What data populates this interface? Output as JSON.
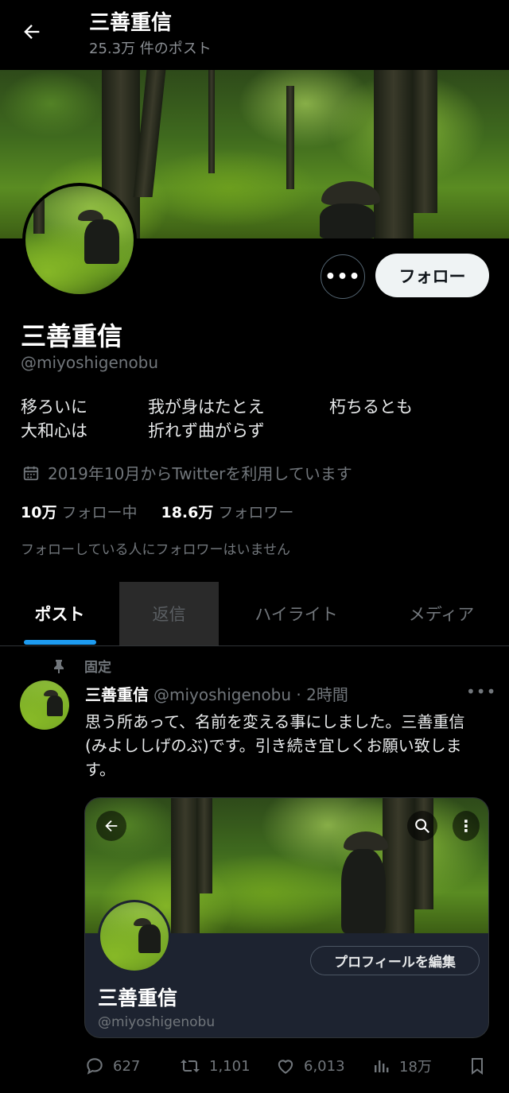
{
  "header": {
    "title": "三善重信",
    "subtitle": "25.3万 件のポスト"
  },
  "profile": {
    "name": "三善重信",
    "handle": "@miyoshigenobu",
    "follow_label": "フォロー",
    "more_label": "•••",
    "bio": {
      "col1": "移ろいに\n大和心は",
      "col2": "我が身はたとえ\n折れず曲がらず",
      "col3": "朽ちるとも"
    },
    "joined": "2019年10月からTwitterを利用しています",
    "following_count": "10万",
    "following_label": "フォロー中",
    "followers_count": "18.6万",
    "followers_label": "フォロワー",
    "mutual_note": "フォローしている人にフォロワーはいません"
  },
  "tabs": [
    {
      "label": "ポスト",
      "active": true
    },
    {
      "label": "返信",
      "active": false
    },
    {
      "label": "ハイライト",
      "active": false
    },
    {
      "label": "メディア",
      "active": false
    }
  ],
  "post": {
    "pinned_label": "固定",
    "author_name": "三善重信",
    "author_meta": "@miyoshigenobu · 2時間",
    "more_label": "•••",
    "text": "思う所あって、名前を変える事にしました。三善重信(みよししげのぶ)です。引き続き宜しくお願い致します。",
    "card": {
      "edit_label": "プロフィールを編集",
      "name": "三善重信",
      "handle": "@miyoshigenobu",
      "kebab": "⋮"
    },
    "actions": {
      "replies": "627",
      "reposts": "1,101",
      "likes": "6,013",
      "views": "18万"
    }
  },
  "colors": {
    "background": "#000000",
    "accent": "#1d9bf0",
    "muted_text": "#71767b",
    "follow_button_bg": "#eff3f4"
  },
  "icons": [
    "back-arrow-icon",
    "more-icon",
    "calendar-icon",
    "pin-icon",
    "reply-icon",
    "retweet-icon",
    "like-icon",
    "views-icon",
    "bookmark-icon",
    "search-icon",
    "kebab-icon"
  ]
}
